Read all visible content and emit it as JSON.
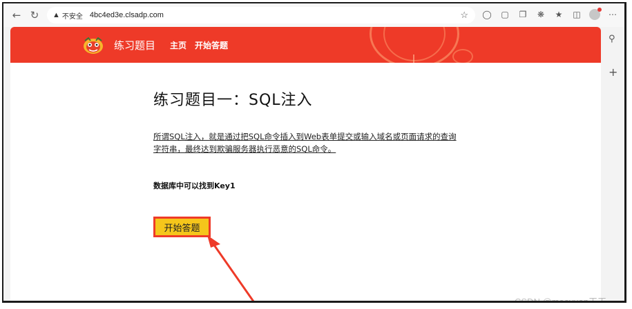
{
  "browser": {
    "security_label": "不安全",
    "url": "4bc4ed3e.clsadp.com"
  },
  "site": {
    "brand": "练习题目",
    "nav": [
      {
        "label": "主页"
      },
      {
        "label": "开始答题"
      }
    ],
    "header_color": "#ee3a28"
  },
  "main": {
    "title": "练习题目一：SQL注入",
    "description": "所谓SQL注入，就是通过把SQL命令插入到Web表单提交或输入域名或页面请求的查询字符串，最终达到欺骗服务器执行恶意的SQL命令。",
    "hint": "数据库中可以找到Key1",
    "start_button": "开始答题",
    "button_color": "#f5c61b"
  },
  "watermark": "CSDN @mooyuan天天",
  "icons": [
    "back-icon",
    "refresh-icon",
    "warning-icon",
    "star-icon",
    "search-icon",
    "plus-icon"
  ]
}
